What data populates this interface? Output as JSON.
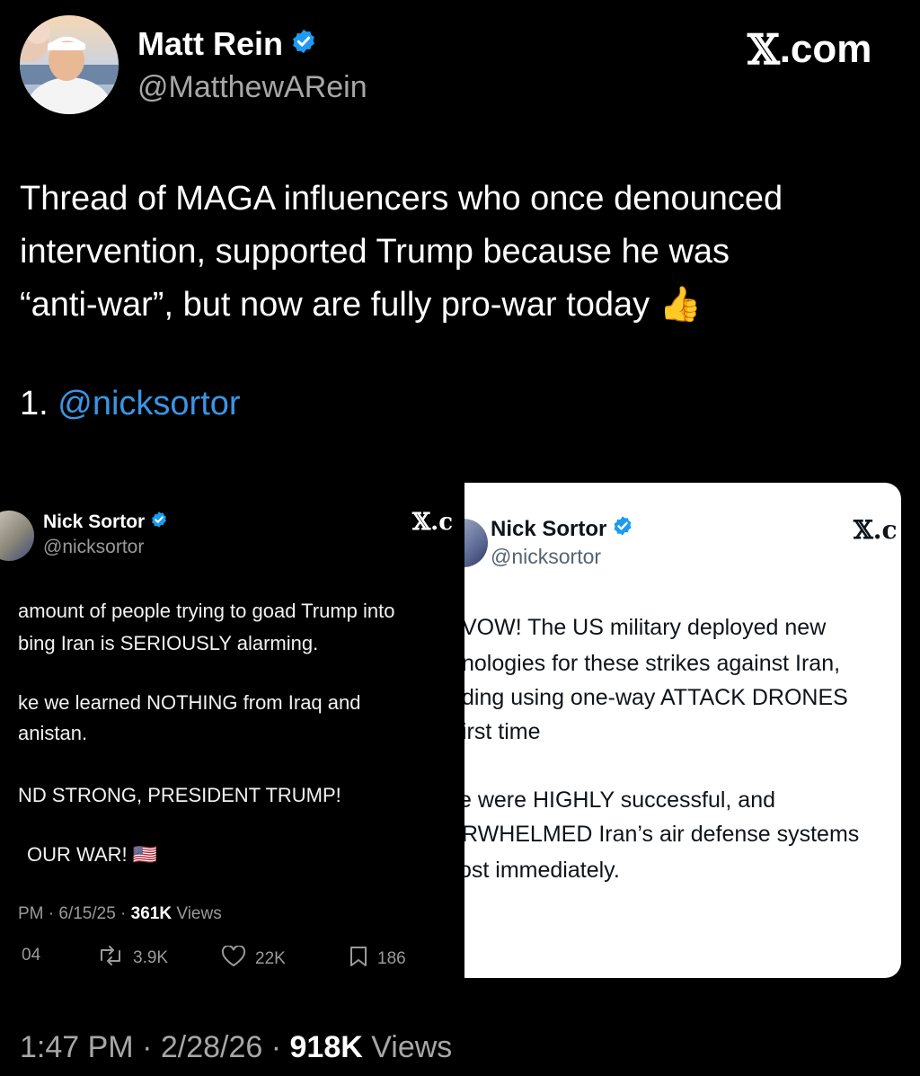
{
  "author": {
    "name": "Matt Rein",
    "handle": "@MatthewARein",
    "avatar_icon": "profile-photo",
    "verified_icon": "verified-badge-icon"
  },
  "brand": {
    "x_glyph": "𝕏",
    "label": ".com"
  },
  "tweet": {
    "lines": [
      "Thread of MAGA influencers who once denounced",
      "intervention, supported Trump because he was",
      "“anti-war”, but now are fully pro-war today 👍"
    ],
    "thread_number": "1.",
    "mention": "@nicksortor"
  },
  "embed_left": {
    "name": "Nick Sortor",
    "handle": "@nicksortor",
    "brand": "𝕏.c",
    "lines": [
      "amount of people trying to goad Trump into",
      "bing Iran is SERIOUSLY alarming.",
      "ke we learned NOTHING from Iraq and",
      "anistan.",
      "ND STRONG, PRESIDENT TRUMP!",
      "OUR WAR! 🇺🇸"
    ],
    "meta_time": "PM · 6/15/25 · ",
    "meta_views": "361K",
    "meta_views_label": " Views",
    "stats": {
      "replies": "04",
      "reposts": "3.9K",
      "likes": "22K",
      "bookmarks": "186"
    }
  },
  "embed_right": {
    "name": "Nick Sortor",
    "handle": "@nicksortor",
    "brand": "𝕏.c",
    "lines": [
      "VOW! The US military deployed new",
      "nologies for these strikes against Iran,",
      "ding using one-way ATTACK DRONES",
      "irst time",
      "e were HIGHLY successful, and",
      "RWHELMED Iran’s air defense systems",
      "ost immediately."
    ]
  },
  "footer": {
    "time": "1:47 PM · 2/28/26 · ",
    "views": "918K",
    "views_label": " Views"
  },
  "colors": {
    "accent": "#3b95e5",
    "verified": "#1d9bf0",
    "background": "#000000"
  }
}
